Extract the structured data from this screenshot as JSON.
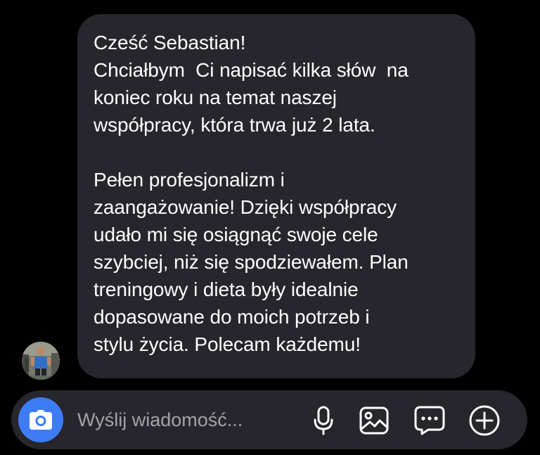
{
  "message": {
    "paragraph1": [
      "Cześć Sebastian!",
      "Chciałbym  Ci napisać kilka słów  na",
      "koniec roku na temat naszej",
      "współpracy, która trwa już 2 lata."
    ],
    "paragraph2": [
      "Pełen profesjonalizm i",
      "zaangażowanie! Dzięki współpracy",
      "udało mi się osiągnąć swoje cele",
      "szybciej, niż się spodziewałem. Plan",
      "treningowy i dieta były idealnie",
      "dopasowane do moich potrzeb i",
      "stylu życia. Polecam każdemu!"
    ]
  },
  "composer": {
    "placeholder": "Wyślij wiadomość..."
  },
  "icons": {
    "camera": "camera-icon",
    "microphone": "microphone-icon",
    "gallery": "image-icon",
    "chat": "chat-bubble-icon",
    "add": "plus-circle-icon"
  },
  "colors": {
    "background": "#000000",
    "bubble": "#26262c",
    "accent": "#3d7cf5",
    "text": "#ffffff",
    "placeholder": "#a3a3a8"
  }
}
